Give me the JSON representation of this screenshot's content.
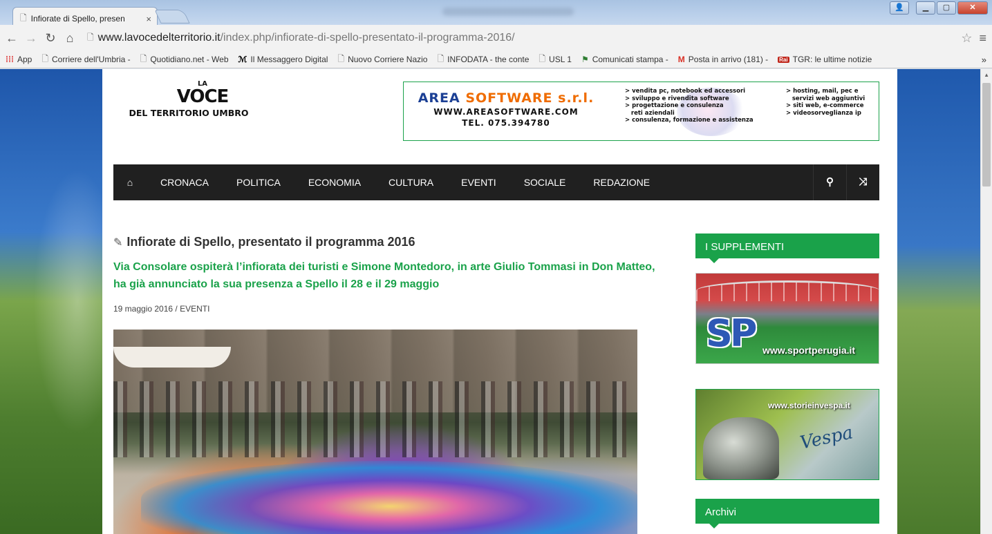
{
  "browser": {
    "tab_title": "Infiorate di Spello, presen",
    "tab_close": "×",
    "url_host": "www.lavocedelterritorio.it",
    "url_path": "/index.php/infiorate-di-spello-presentato-il-programma-2016/",
    "bookmarks": [
      {
        "label": "App",
        "icon": "apps-icon"
      },
      {
        "label": "Corriere dell'Umbria -",
        "icon": "page-icon"
      },
      {
        "label": "Quotidiano.net - Web",
        "icon": "page-icon"
      },
      {
        "label": "Il Messaggero Digital",
        "icon": "messaggero-icon"
      },
      {
        "label": "Nuovo Corriere Nazio",
        "icon": "page-icon"
      },
      {
        "label": "INFODATA - the conte",
        "icon": "page-icon"
      },
      {
        "label": "USL 1",
        "icon": "page-icon"
      },
      {
        "label": "Comunicati stampa -",
        "icon": "flag-icon"
      },
      {
        "label": "Posta in arrivo (181) -",
        "icon": "gmail-icon"
      },
      {
        "label": "TGR: le ultime notizie",
        "icon": "rai-icon"
      }
    ],
    "bookmarks_more": "»"
  },
  "header": {
    "logo_la": "LA",
    "logo_voce": "VOCE",
    "logo_sub": "DEL TERRITORIO UMBRO",
    "banner": {
      "name_a": "AREA",
      "name_b": "SOFTWARE s.r.l.",
      "url": "WWW.AREASOFTWARE.COM",
      "tel": "TEL. 075.394780",
      "services_left": [
        "> vendita pc, notebook ed accessori",
        "> sviluppo e rivendita software",
        "> progettazione e consulenza",
        "   reti aziendali",
        "> consulenza, formazione e assistenza"
      ],
      "services_right": [
        "> hosting, mail, pec e",
        "   servizi web aggiuntivi",
        "> siti web, e-commerce",
        "> videosorveglianza ip"
      ]
    }
  },
  "nav": {
    "items": [
      "CRONACA",
      "POLITICA",
      "ECONOMIA",
      "CULTURA",
      "EVENTI",
      "SOCIALE",
      "REDAZIONE"
    ]
  },
  "article": {
    "title": "Infiorate di Spello, presentato il programma 2016",
    "subtitle": "Via Consolare ospiterà l’infiorata dei turisti e Simone Montedoro, in arte Giulio Tommasi in Don Matteo, ha già annunciato la sua presenza a Spello il 28 e il 29 maggio",
    "meta": "19 maggio 2016 / EVENTI"
  },
  "sidebar": {
    "supplementi_title": "I SUPPLEMENTI",
    "sport_logo": "SP",
    "sport_url": "www.sportperugia.it",
    "vespa_url": "www.storieinvespa.it",
    "vespa_script": "Vespa",
    "archivi_title": "Archivi"
  },
  "colors": {
    "accent_green": "#1aa24a",
    "nav_bg": "#202020",
    "banner_blue": "#1b3f94",
    "banner_orange": "#ef6c00"
  }
}
